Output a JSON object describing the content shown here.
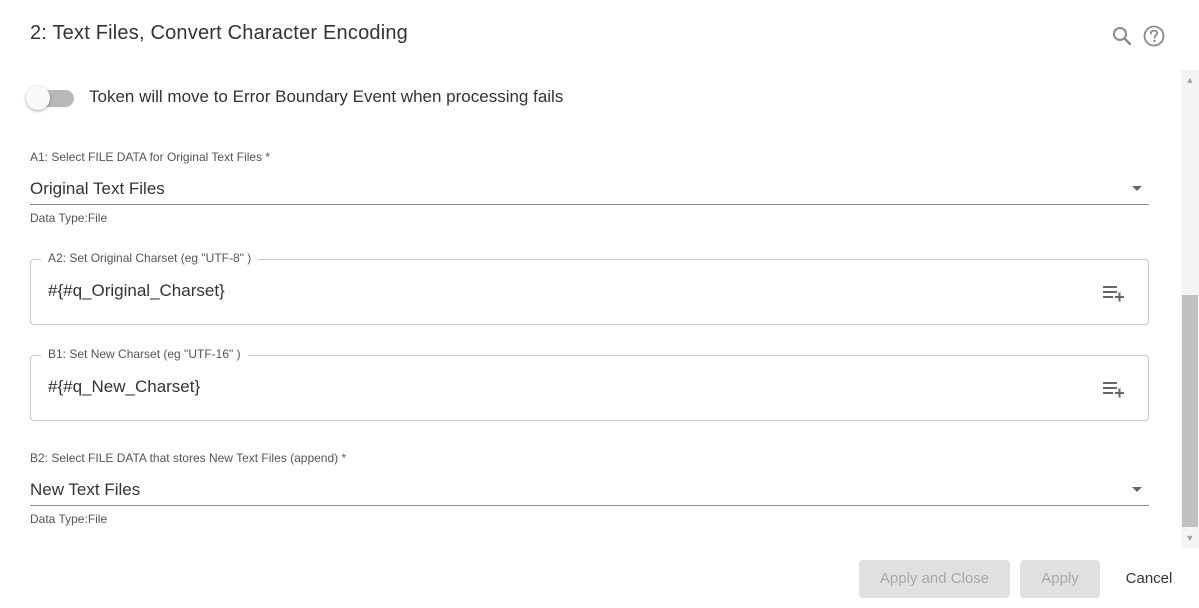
{
  "dialog": {
    "title": "2: Text Files, Convert Character Encoding",
    "icons": {
      "search": "search-icon",
      "help": "help-icon"
    }
  },
  "toggle": {
    "label": "Token will move to Error Boundary Event when processing fails",
    "checked": false
  },
  "fields": {
    "a1": {
      "label": "A1: Select FILE DATA for Original Text Files *",
      "value": "Original Text Files",
      "data_type": "Data Type:File"
    },
    "a2": {
      "label": "A2: Set Original Charset (eg \"UTF-8\" )",
      "value": "#{#q_Original_Charset}"
    },
    "b1": {
      "label": "B1: Set New Charset (eg \"UTF-16\" )",
      "value": "#{#q_New_Charset}"
    },
    "b2": {
      "label": "B2: Select FILE DATA that stores New Text Files (append) *",
      "value": "New Text Files",
      "data_type": "Data Type:File"
    }
  },
  "footer": {
    "apply_close_label": "Apply and Close",
    "apply_label": "Apply",
    "cancel_label": "Cancel"
  },
  "colors": {
    "text": "#333333",
    "disabled_bg": "#e0e0e0",
    "disabled_text": "#a8a8a8",
    "toggle_track": "#b9b9b9"
  }
}
